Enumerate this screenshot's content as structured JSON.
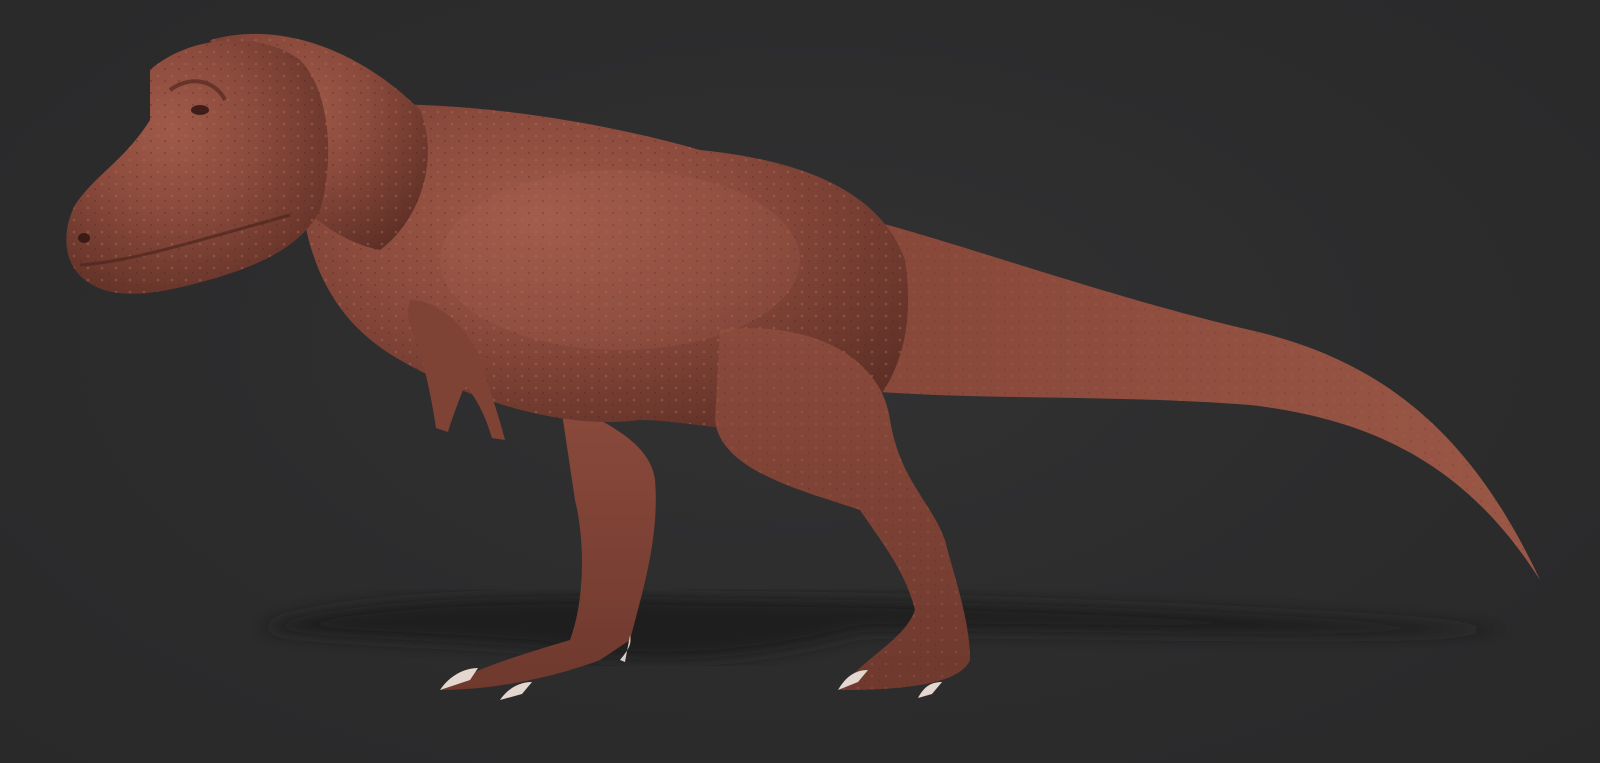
{
  "scene": {
    "background_color": "#2b2b2c",
    "subject": "tyrannosaurus-sculpt",
    "subject_color": "#8a4a3c",
    "shadow_color": "#1f1f20"
  }
}
